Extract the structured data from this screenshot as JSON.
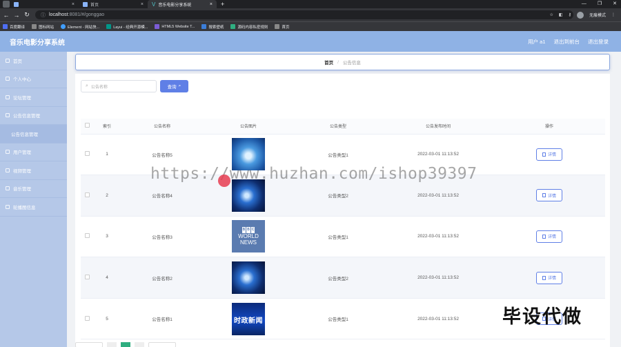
{
  "browser": {
    "tabs": [
      {
        "label": ""
      },
      {
        "label": "首页"
      },
      {
        "label": "音乐电影分享系统"
      }
    ],
    "new_tab": "+",
    "url_host": "localhost",
    "url_path": ":8081/#/gonggao",
    "profile_label": "无痕模式",
    "bookmarks": [
      {
        "label": "百度翻译",
        "color": "#4e6ef2"
      },
      {
        "label": "图标网站",
        "color": "#444"
      },
      {
        "label": "Element - 网站快...",
        "color": "#409eff"
      },
      {
        "label": "Layui - 经典开源模...",
        "color": "#009688"
      },
      {
        "label": "HTML5 Website T...",
        "color": "#7b5cd6"
      },
      {
        "label": "搜索壁纸",
        "color": "#3b7dd8"
      },
      {
        "label": "源码内容私密规则",
        "color": "#2fae80"
      },
      {
        "label": "首页",
        "color": "#888"
      }
    ]
  },
  "app": {
    "title": "音乐电影分享系统",
    "header_links": [
      "用户 a1",
      "退出到前台",
      "退出登录"
    ]
  },
  "sidebar": {
    "items": [
      {
        "label": "首页",
        "sub": false
      },
      {
        "label": "个人中心",
        "sub": false
      },
      {
        "label": "论坛管理",
        "sub": false
      },
      {
        "label": "公告信息管理",
        "sub": false
      },
      {
        "label": "公告信息管理",
        "sub": true
      },
      {
        "label": "用户管理",
        "sub": false
      },
      {
        "label": "视频管理",
        "sub": false
      },
      {
        "label": "音乐管理",
        "sub": false
      },
      {
        "label": "轮播图信息",
        "sub": false
      }
    ]
  },
  "breadcrumb": {
    "home": "首页",
    "separator": "/",
    "current": "公告信息"
  },
  "search": {
    "placeholder": "公告名称",
    "button_label": "查询"
  },
  "table": {
    "headers": [
      "索引",
      "公告名称",
      "公告图片",
      "公告类型",
      "公告发布时间",
      "操作"
    ],
    "rows": [
      {
        "index": "1",
        "name": "公告名称5",
        "image": "blue1",
        "image_text": "",
        "type": "公告类型1",
        "time": "2022-03-01 11:13:52",
        "action": "详情"
      },
      {
        "index": "2",
        "name": "公告名称4",
        "image": "blue2",
        "image_text": "",
        "type": "公告类型2",
        "time": "2022-03-01 11:13:52",
        "action": "详情"
      },
      {
        "index": "3",
        "name": "公告名称3",
        "image": "bbc",
        "image_text": "WORLD NEWS",
        "type": "公告类型1",
        "time": "2022-03-01 11:13:52",
        "action": "详情"
      },
      {
        "index": "4",
        "name": "公告名称2",
        "image": "blue2",
        "image_text": "",
        "type": "公告类型2",
        "time": "2022-03-01 11:13:52",
        "action": "详情"
      },
      {
        "index": "5",
        "name": "公告名称1",
        "image": "news",
        "image_text": "时政新闻",
        "type": "公告类型1",
        "time": "2022-03-01 11:13:52",
        "action": "详情"
      }
    ]
  },
  "overlay": {
    "watermark": "https://www.huzhan.com/ishop39397",
    "stamp": "毕设代做"
  }
}
